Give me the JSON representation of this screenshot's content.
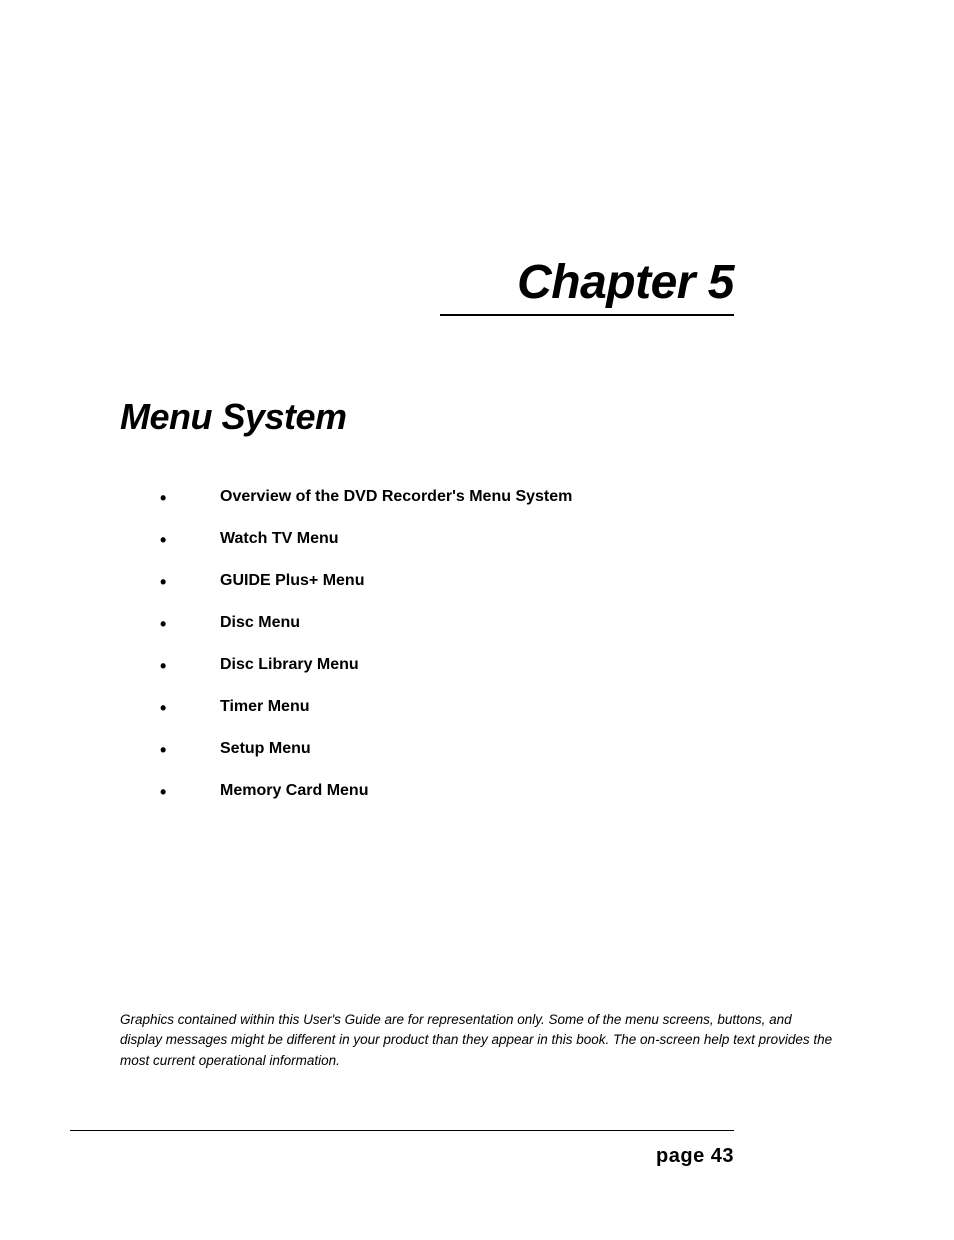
{
  "chapter": {
    "title": "Chapter 5"
  },
  "section": {
    "title": "Menu System"
  },
  "toc": {
    "items": [
      "Overview of the DVD Recorder's Menu System",
      "Watch TV Menu",
      "GUIDE Plus+ Menu",
      "Disc Menu",
      "Disc Library Menu",
      "Timer Menu",
      "Setup Menu",
      "Memory Card Menu"
    ]
  },
  "disclaimer": "Graphics contained within this User's Guide are for representation only. Some of the menu screens, buttons, and display messages might be different in your product than they appear in this book. The on-screen help text provides the most current operational information.",
  "footer": {
    "page_label": "page 43"
  }
}
